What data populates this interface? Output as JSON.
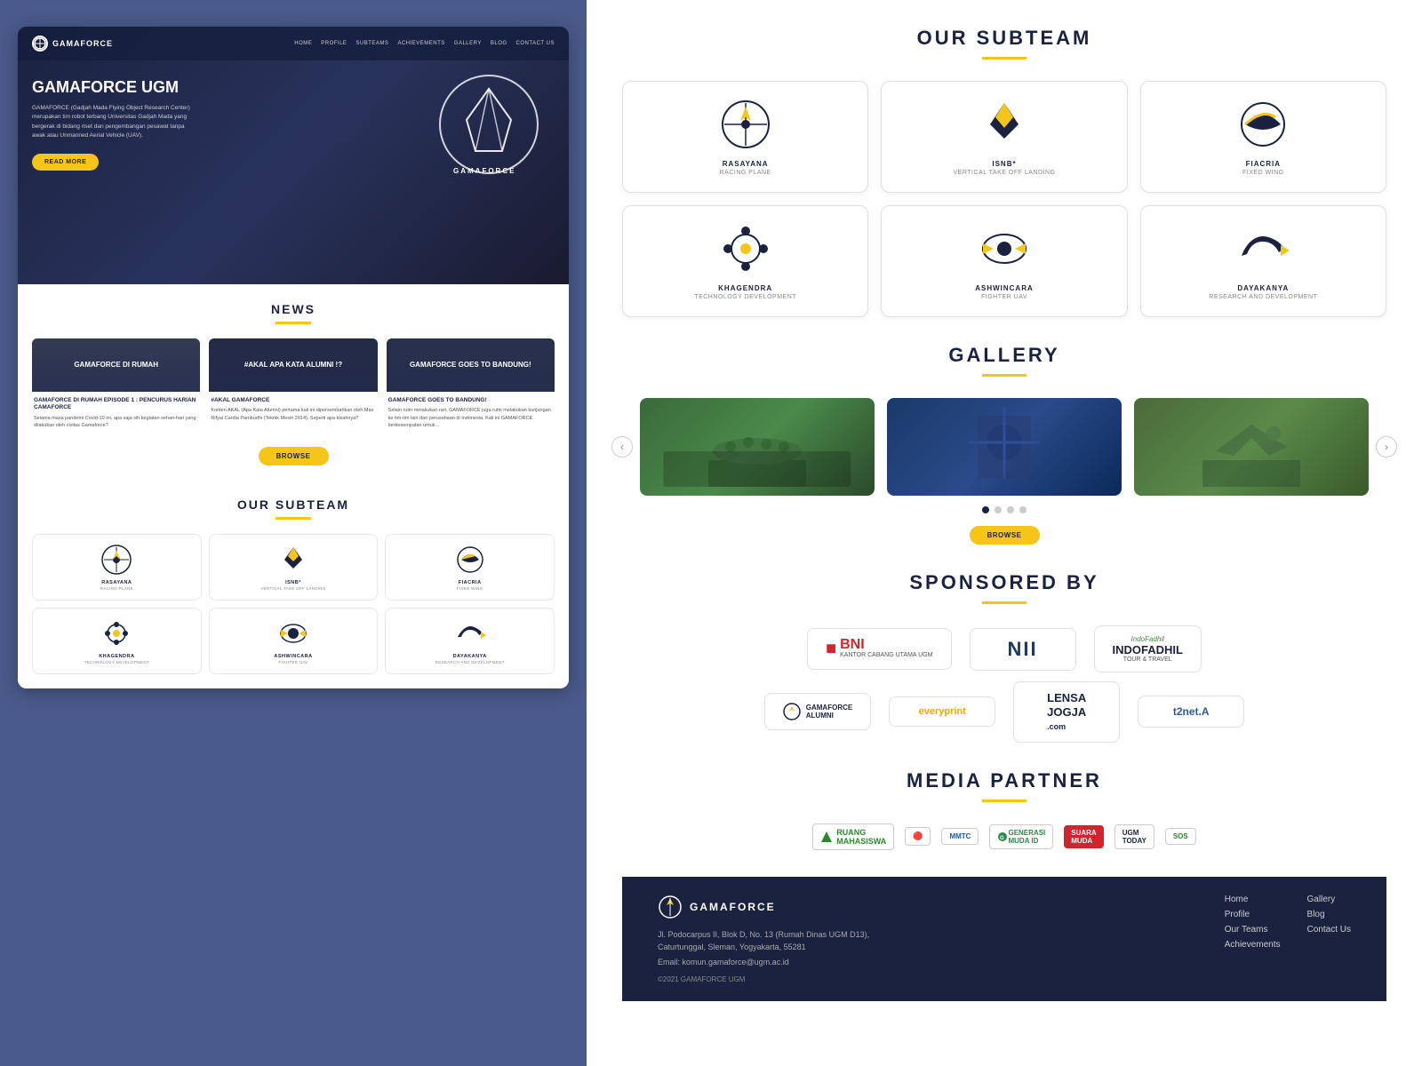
{
  "bg_color": "#4a5a8a",
  "left": {
    "nav": {
      "logo_text": "GAMAFORCE",
      "links": [
        "HOME",
        "PROFILE",
        "SUBTEAMS",
        "ACHIEVEMENTS",
        "GALLERY",
        "BLOG",
        "CONTACT US"
      ]
    },
    "hero": {
      "title": "GAMAFORCE UGM",
      "description": "GAMAFORCE (Gadjah Mada Flying Object Research Center) merupakan tim robot terbang Universitas Gadjah Mada yang bergerak di bidang riset dan pengembangan pesawat tanpa awak atau Unmanned Aerial Vehicle (UAV).",
      "cta": "READ MORE"
    },
    "news": {
      "title": "NEWS",
      "cards": [
        {
          "img_label": "GAMAFORCE DI RUMAH",
          "title": "GAMAFORCE DI RUMAH EPISODE 1 : PENCURUS HARIAN CAMAFORCE",
          "text": "Selama masa pandemi Covid-19 ini, apa saja sih kegiatan sehari-hari yang dilakukan oleh civitas Gamaforce?"
        },
        {
          "img_label": "#AKAL APA KATA ALUMNI !?",
          "title": "#AKAL GAMAFORCE",
          "text": "Konten AKAL (Apa Kata Alumni) pertama kali ini dipersembahkan oleh Max Rifyal Cardia Pambudhi (Teknik Mesin 2014). Seperti apa kisahnya?"
        },
        {
          "img_label": "GAMAFORCE GOES TO BANDUNG!",
          "title": "GAMAFORCE GOES TO BANDUNG!",
          "text": "Selain rutin melakukan rart, GAMAFORCE juga rutin melakukan kunjungan ke tim-tim lain dan perusahaan di Indonesia. Kali ini GAMAFORCE berkesempatan untuk..."
        }
      ],
      "browse": "BROWSE"
    },
    "subteam": {
      "title": "OUR SUBTEAM",
      "cards": [
        {
          "name": "RASAYANA",
          "desc": "RACING PLANE"
        },
        {
          "name": "ISNB*",
          "desc": "VERTICAL TAKE OFF LANDING"
        },
        {
          "name": "FIACRIA",
          "desc": "FIXED WING"
        },
        {
          "name": "KHAGENDRA",
          "desc": "TECHNOLOGY DEVELOPMENT"
        },
        {
          "name": "ASHWINCARA",
          "desc": "FIGHTER UAV"
        },
        {
          "name": "DAYAKANYA",
          "desc": "RESEARCH AND DEVELOPMENT"
        }
      ]
    }
  },
  "right": {
    "subteam": {
      "title": "OUR SUBTEAM",
      "cards": [
        {
          "name": "RASAYANA",
          "desc": "RACING PLANE"
        },
        {
          "name": "ISNB*",
          "desc": "VERTICAL TAKE OFF LANDING"
        },
        {
          "name": "FIACRIA",
          "desc": "FIXED WING"
        },
        {
          "name": "KHAGENDRA",
          "desc": "TECHNOLOGY DEVELOPMENT"
        },
        {
          "name": "ASHWINCARA",
          "desc": "FIGHTER UAV"
        },
        {
          "name": "DAYAKANYA",
          "desc": "RESEARCH AND DEVELOPMENT"
        }
      ]
    },
    "gallery": {
      "title": "GALLERY",
      "browse": "BROWSE"
    },
    "sponsored": {
      "title": "SPONSORED BY",
      "sponsors": [
        "BNI",
        "NII",
        "INDOFADHIL TOUR & TRAVEL",
        "GAMAFORCE ALUMNI",
        "everyprint",
        "LENSA JOGJA .com",
        "t2net.A"
      ]
    },
    "media": {
      "title": "MEDIA PARTNER",
      "partners": [
        "RUANG MAHASISWA",
        "MMTC",
        "GENERASI MUDA ID",
        "SUARA MUDA",
        "UGM TODAY",
        "SOS"
      ]
    },
    "footer": {
      "logo": "GAMAFORCE",
      "address": "Jl. Podocarpus II, Blok D, No. 13 (Rumah Dinas UGM D13),\nCaturtunggal, Sleman, Yogyakarta, 55281",
      "email": "Email: komun.gamaforce@ugm.ac.id",
      "copyright": "©2021 GAMAFORCE UGM",
      "links_col1": [
        "Home",
        "Profile",
        "Our Teams",
        "Achievements"
      ],
      "links_col2": [
        "Gallery",
        "Blog",
        "Contact Us"
      ]
    }
  }
}
